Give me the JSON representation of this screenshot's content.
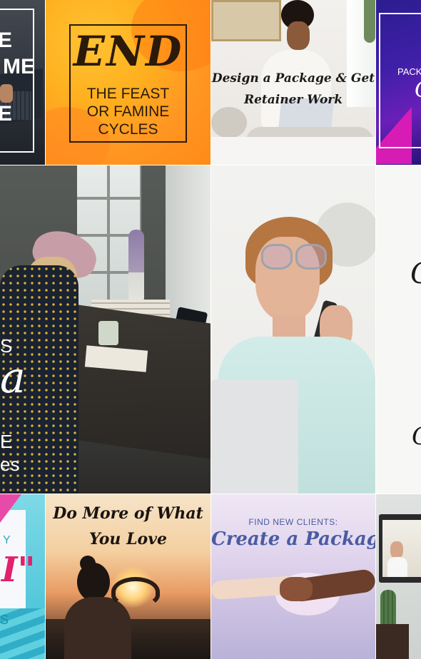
{
  "tiles": {
    "t1": {
      "line1": "E",
      "line2": "ME",
      "line3": "E"
    },
    "t2": {
      "script": "END",
      "line1": "THE FEAST",
      "line2": "OR FAMINE",
      "line3": "CYCLES"
    },
    "t3": {
      "line1": "Design a Package & Get",
      "line2": "Retainer Work"
    },
    "t4": {
      "caps": "PACK",
      "script": "C"
    },
    "t5": {
      "caps1": "s",
      "script": "a",
      "caps2": "e",
      "caps3": "es"
    },
    "t7": {
      "script1": "C",
      "script2": "C"
    },
    "t8": {
      "caps1": "Y",
      "script": "I\"",
      "caps2": "S"
    },
    "t9": {
      "line1": "Do More of What",
      "line2": "You Love"
    },
    "t10": {
      "caps": "FIND NEW CLIENTS:",
      "script": "Create a Package"
    }
  }
}
